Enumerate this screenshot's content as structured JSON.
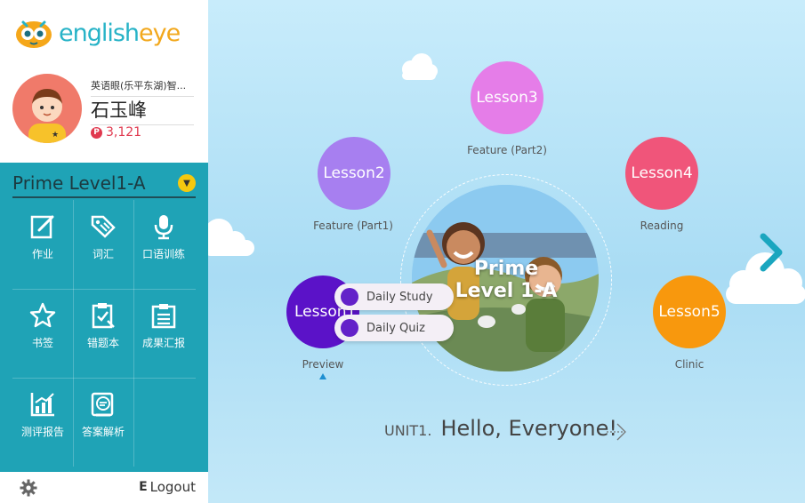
{
  "brand": {
    "logo_english": "english",
    "logo_eye": "eye",
    "accent": "#1fa3b6"
  },
  "profile": {
    "school": "英语眼(乐平东湖)智...",
    "name": "石玉峰",
    "points_badge": "P",
    "points": "3,121"
  },
  "level_selector": {
    "label": "Prime Level1-A"
  },
  "menu": [
    {
      "label": "作业",
      "icon": "homework-icon"
    },
    {
      "label": "词汇",
      "icon": "vocabulary-tag-icon"
    },
    {
      "label": "口语训练",
      "icon": "microphone-icon"
    },
    {
      "label": "书签",
      "icon": "star-icon"
    },
    {
      "label": "错题本",
      "icon": "clipboard-check-icon"
    },
    {
      "label": "成果汇报",
      "icon": "report-list-icon"
    },
    {
      "label": "测评报告",
      "icon": "chart-icon"
    },
    {
      "label": "答案解析",
      "icon": "answer-book-icon"
    }
  ],
  "footer": {
    "logout_icon": "E",
    "logout": "Logout"
  },
  "lessons": {
    "lesson1": {
      "label": "Lesson1",
      "sub": "Preview",
      "color": "#5b12c8"
    },
    "lesson2": {
      "label": "Lesson2",
      "sub": "Feature (Part1)",
      "color": "#a77ff0"
    },
    "lesson3": {
      "label": "Lesson3",
      "sub": "Feature (Part2)",
      "color": "#e57de8"
    },
    "lesson4": {
      "label": "Lesson4",
      "sub": "Reading",
      "color": "#f0557a"
    },
    "lesson5": {
      "label": "Lesson5",
      "sub": "Clinic",
      "color": "#f8980d"
    }
  },
  "center": {
    "title_line1": "Prime",
    "title_line2": "Level 1-A"
  },
  "popup": {
    "daily_study": "Daily Study",
    "daily_quiz": "Daily Quiz"
  },
  "unit": {
    "number": "UNIT1.",
    "title": "Hello, Everyone!"
  }
}
